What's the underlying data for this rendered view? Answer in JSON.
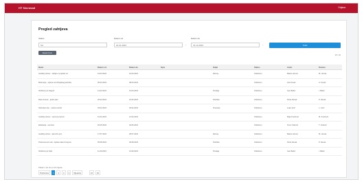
{
  "header": {
    "brand": "HT Novosad",
    "user": "Odjava"
  },
  "page": {
    "title": "Pregled zahtjeva"
  },
  "filters": {
    "status_label": "Status",
    "status_value": "Svi",
    "date_from_label": "Datum od",
    "date_from_value": "01.01.2023",
    "date_to_label": "Datum do",
    "date_to_value": "31.12.2023",
    "search_label": "Traži",
    "export_label": "Excel izvoz",
    "row_count": "10 / 10"
  },
  "table": {
    "columns": [
      "Naziv",
      "Datum od",
      "Datum do",
      "Opis",
      "Odjel",
      "Status",
      "Autor",
      "Kreirao"
    ],
    "rows": [
      [
        "Godišnji odmor - zahtjev za tjedan 12",
        "01.03.2023",
        "10.03.2023",
        "",
        "Razvoj",
        "Odobreno",
        "Marko Horvat",
        "M. Horvat"
      ],
      [
        "Bolovanje - prijava od obiteljskog liječnika",
        "06.03.2023",
        "08.03.2023",
        "",
        "",
        "Odobreno",
        "Ana Kovač",
        "A. Kovač"
      ],
      [
        "Službeni put Zagreb",
        "14.03.2023",
        "16.03.2023",
        "",
        "Prodaja",
        "Odobreno",
        "Ivan Babić",
        "I. Babić"
      ],
      [
        "Rad od kuće - tjedni plan",
        "20.03.2023",
        "24.03.2023",
        "",
        "Podrška",
        "Odobreno",
        "Petra Novak",
        "P. Novak"
      ],
      [
        "Slobodan dan - osobni razlozi",
        "03.04.2023",
        "03.04.2023",
        "",
        "Financije",
        "Odobreno",
        "Luka Jurić",
        "L. Jurić"
      ],
      [
        "Godišnji odmor - uskrsni praznici",
        "10.04.2023",
        "14.04.2023",
        "",
        "",
        "Odobreno",
        "Maja Knežević",
        "M. Knežević"
      ],
      [
        "Edukacija - seminar",
        "02.05.2023",
        "04.05.2023",
        "",
        "",
        "Odobreno",
        "Tomo Vuković",
        "T. Vuković"
      ],
      [
        "Godišnji odmor - ljetni dio prvi",
        "17.07.2023",
        "28.07.2023",
        "",
        "Razvoj",
        "Odobreno",
        "Marko Horvat",
        "M. Horvat"
      ],
      [
        "Prekovremeni rad - isplata vikend smjena",
        "05.08.2023",
        "06.08.2023",
        "",
        "Podrška",
        "Odobreno",
        "Petra Novak",
        "P. Novak"
      ],
      [
        "Službeni put Split",
        "11.09.2023",
        "13.09.2023",
        "",
        "Prodaja",
        "Odobreno",
        "Ivan Babić",
        "I. Babić"
      ]
    ]
  },
  "pagination": {
    "info": "Prikaz 1 do 10 od 10 zapisa",
    "prev": "Prethodna",
    "pages": [
      "1",
      "2",
      "3",
      "4"
    ],
    "active": "1",
    "next": "Sljedeća",
    "extra": [
      "10",
      "Idi"
    ]
  }
}
